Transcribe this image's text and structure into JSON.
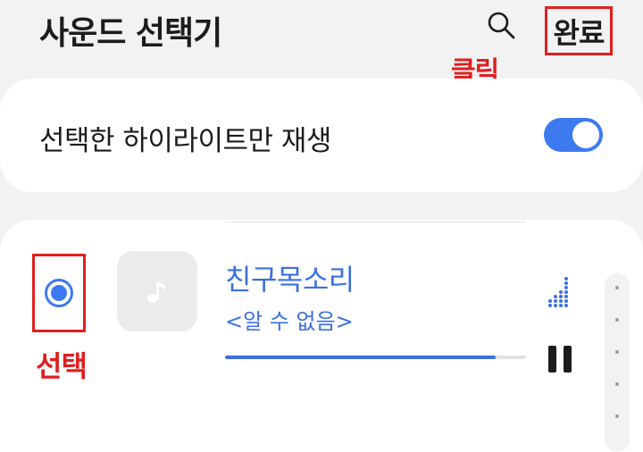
{
  "header": {
    "title": "사운드 선택기",
    "search_icon": "search-icon",
    "done_label": "완료"
  },
  "annotations": {
    "click": "클릭",
    "select": "선택",
    "highlight_color": "#e01f1f"
  },
  "toggle_row": {
    "label": "선택한 하이라이트만 재생",
    "enabled": true
  },
  "song": {
    "title": "친구목소리",
    "artist": "<알 수 없음>",
    "selected": true,
    "progress": 0.9,
    "thumb_icon": "music-note-icon",
    "playing_icon": "equalizer-icon",
    "pause_icon": "pause-icon"
  },
  "colors": {
    "accent": "#3b70df",
    "switch_on": "#3d7af0"
  }
}
